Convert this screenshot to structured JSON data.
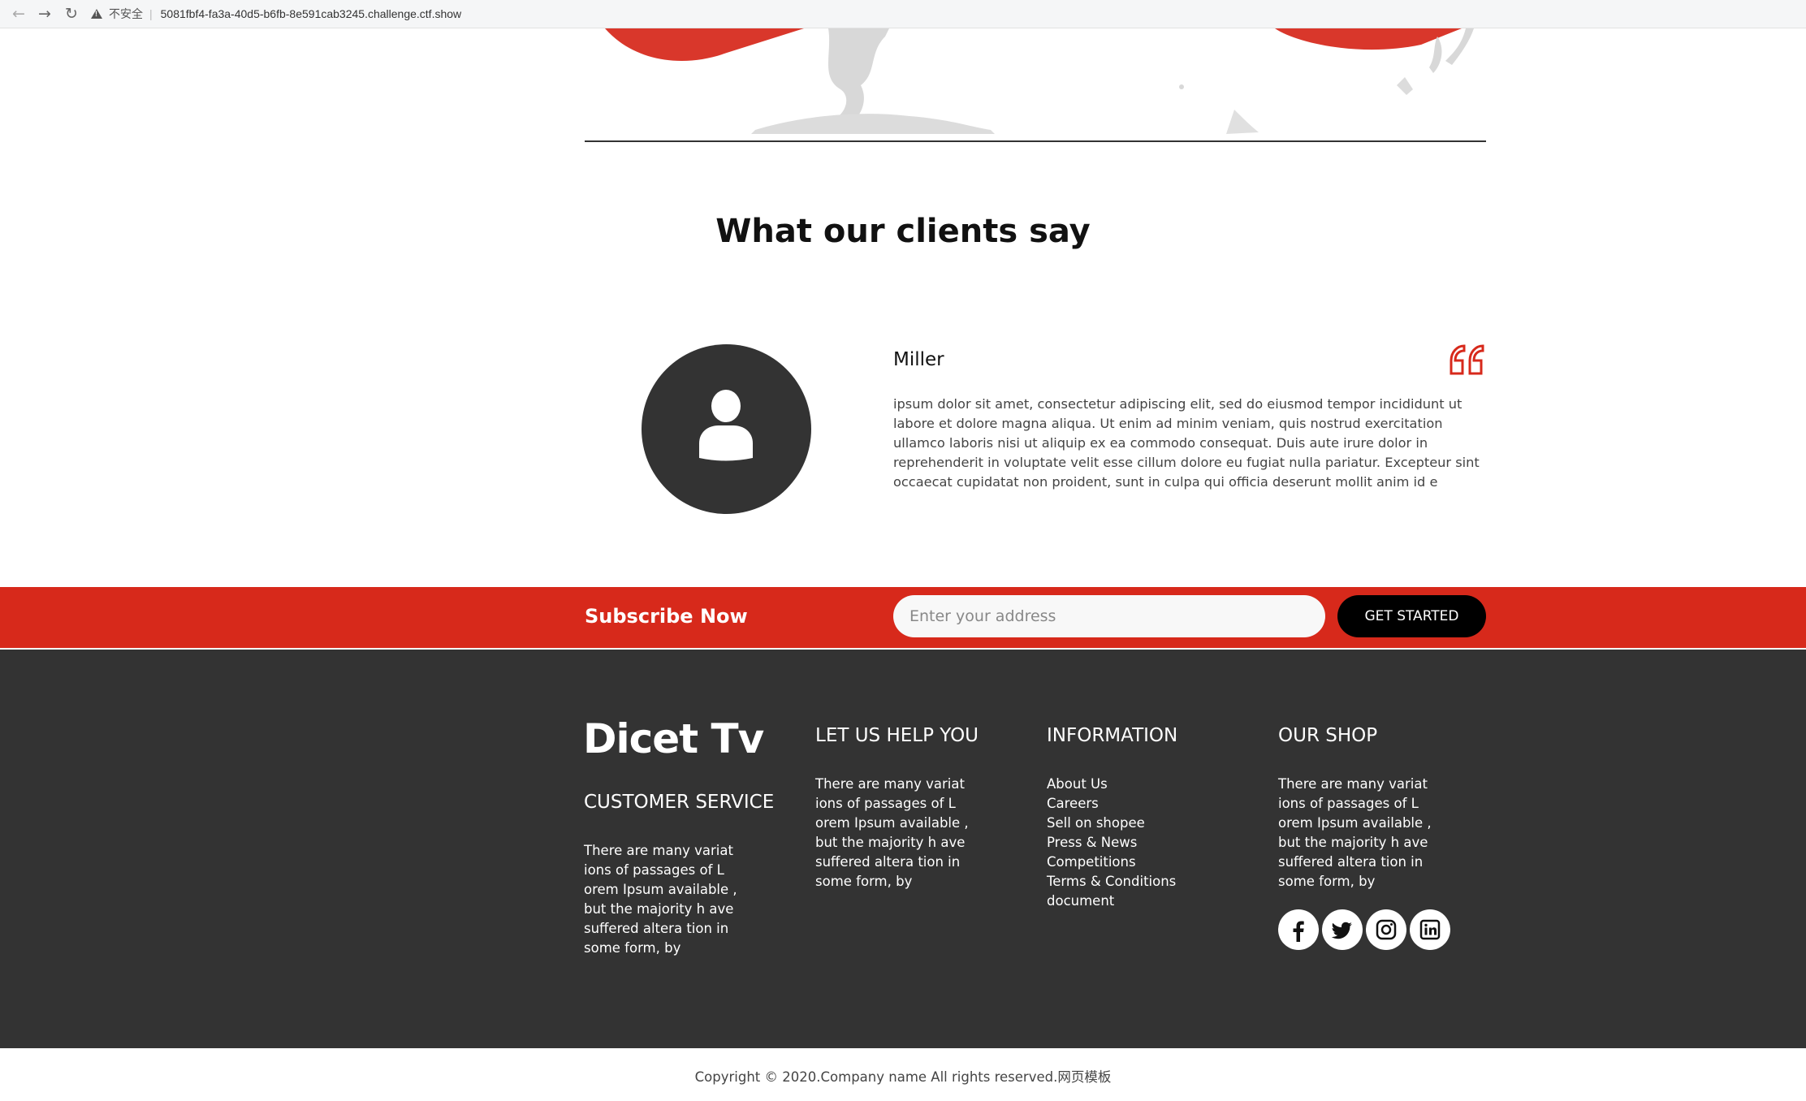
{
  "browser": {
    "security_label": "不安全",
    "url": "5081fbf4-fa3a-40d5-b6fb-8e591cab3245.challenge.ctf.show"
  },
  "testimonials": {
    "title": "What our clients say",
    "client_name": "Miller",
    "text": "ipsum dolor sit amet, consectetur adipiscing elit, sed do eiusmod tempor incididunt ut labore et dolore magna aliqua. Ut enim ad minim veniam, quis nostrud exercitation ullamco laboris nisi ut aliquip ex ea commodo consequat. Duis aute irure dolor in reprehenderit in voluptate velit esse cillum dolore eu fugiat nulla pariatur. Excepteur sint occaecat cupidatat non proident, sunt in culpa qui officia deserunt mollit anim id e"
  },
  "subscribe": {
    "title": "Subscribe Now",
    "placeholder": "Enter your address",
    "button": "GET STARTED"
  },
  "footer": {
    "brand": "Dicet Tv",
    "customer_service": {
      "heading": "CUSTOMER SERVICE",
      "text": "There are many variat ions of passages of L orem Ipsum available , but the majority h ave suffered altera tion in some form, by"
    },
    "help": {
      "heading": "LET US HELP YOU",
      "text": "There are many variat ions of passages of L orem Ipsum available , but the majority h ave suffered altera tion in some form, by"
    },
    "information": {
      "heading": "INFORMATION",
      "links": [
        "About Us",
        "Careers",
        "Sell on shopee",
        "Press & News",
        "Competitions",
        "Terms & Conditions",
        "document"
      ]
    },
    "shop": {
      "heading": "OUR SHOP",
      "text": "There are many variat ions of passages of L orem Ipsum available , but the majority h ave suffered altera tion in some form, by"
    },
    "socials": [
      "facebook-icon",
      "twitter-icon",
      "instagram-icon",
      "linkedin-icon"
    ]
  },
  "copyright": "Copyright © 2020.Company name All rights reserved.网页模板",
  "colors": {
    "accent": "#d7291b",
    "dark": "#333333"
  }
}
